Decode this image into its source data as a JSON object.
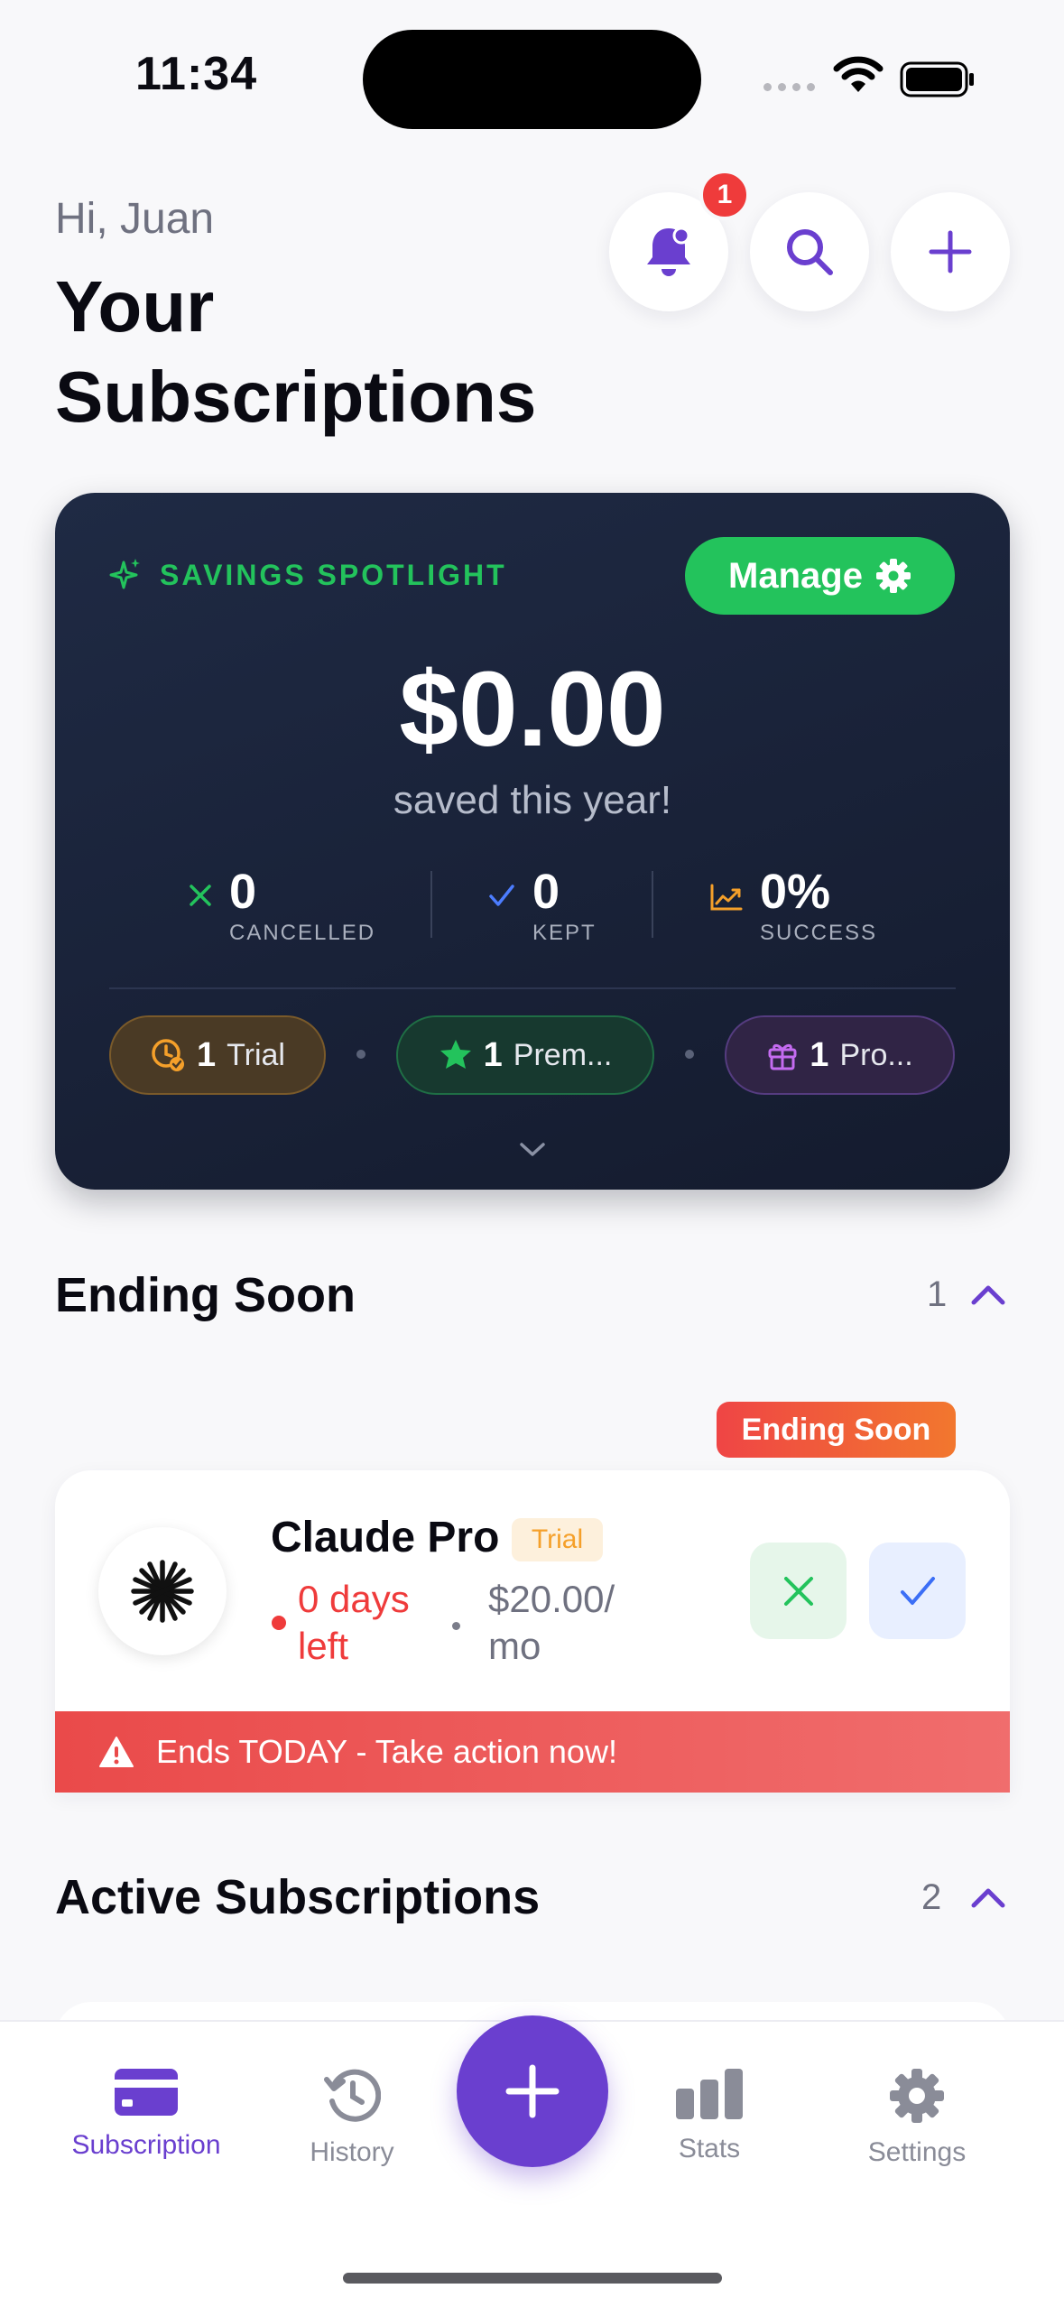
{
  "status_bar": {
    "time": "11:34"
  },
  "header": {
    "greeting": "Hi, Juan",
    "title_line1": "Your",
    "title_line2": "Subscriptions",
    "notification_count": "1"
  },
  "spotlight": {
    "label": "SAVINGS SPOTLIGHT",
    "manage_label": "Manage",
    "amount": "$0.00",
    "amount_caption": "saved this year!",
    "stats": [
      {
        "value": "0",
        "label": "CANCELLED",
        "icon": "x-icon"
      },
      {
        "value": "0",
        "label": "KEPT",
        "icon": "check-icon"
      },
      {
        "value": "0%",
        "label": "SUCCESS",
        "icon": "trend-up-icon"
      }
    ],
    "pills": [
      {
        "count": "1",
        "label": "Trial",
        "icon": "clock-check-icon"
      },
      {
        "count": "1",
        "label": "Prem...",
        "icon": "star-icon"
      },
      {
        "count": "1",
        "label": "Pro...",
        "icon": "gift-icon"
      }
    ]
  },
  "ending_soon": {
    "title": "Ending Soon",
    "count": "1",
    "badge": "Ending Soon",
    "item": {
      "name": "Claude Pro",
      "tag": "Trial",
      "days_left": "0 days left",
      "price": "$20.00/ mo",
      "warning": "Ends TODAY - Take action now!"
    }
  },
  "active": {
    "title": "Active Subscriptions",
    "count": "2"
  },
  "tabs": [
    {
      "label": "Subscription",
      "icon": "card-icon",
      "active": true
    },
    {
      "label": "History",
      "icon": "history-icon"
    },
    {
      "label": "Stats",
      "icon": "bar-chart-icon"
    },
    {
      "label": "Settings",
      "icon": "gear-icon"
    }
  ],
  "colors": {
    "accent": "#6a3fcf",
    "success": "#23c35c",
    "danger": "#ef3b3b",
    "card_bg": "#1a2238"
  }
}
